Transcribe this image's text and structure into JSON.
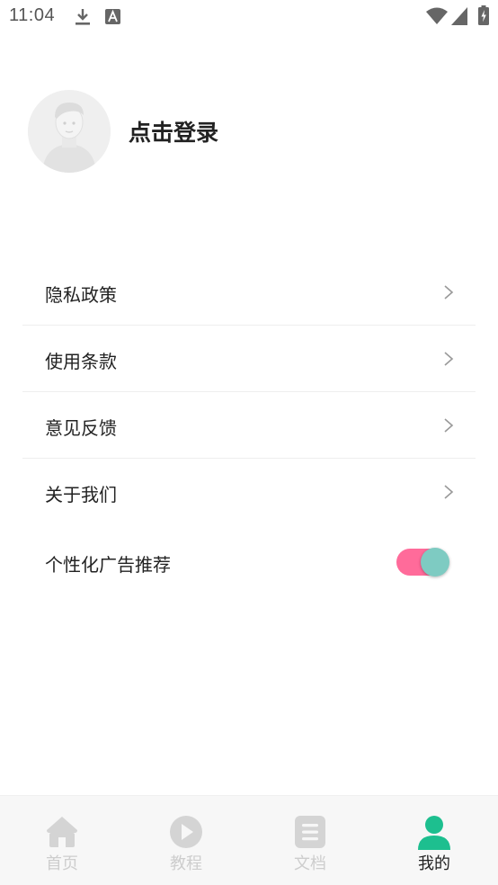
{
  "status_bar": {
    "time": "11:04",
    "icons": [
      "download-icon",
      "font-a-icon",
      "wifi-icon",
      "signal-icon",
      "battery-charging-icon"
    ]
  },
  "profile": {
    "login_label": "点击登录",
    "avatar_icon": "default-avatar-icon"
  },
  "menu": {
    "items": [
      {
        "label": "隐私政策",
        "icon": "chevron-right-icon"
      },
      {
        "label": "使用条款",
        "icon": "chevron-right-icon"
      },
      {
        "label": "意见反馈",
        "icon": "chevron-right-icon"
      },
      {
        "label": "关于我们",
        "icon": "chevron-right-icon"
      }
    ]
  },
  "ad_toggle": {
    "label": "个性化广告推荐",
    "enabled": true,
    "track_color": "#ff6b9a",
    "thumb_color": "#7ecbc2"
  },
  "bottom_nav": {
    "active_color": "#1dbf8f",
    "inactive_color": "#cdcdcd",
    "tabs": [
      {
        "label": "首页",
        "icon": "home-icon",
        "active": false
      },
      {
        "label": "教程",
        "icon": "play-circle-icon",
        "active": false
      },
      {
        "label": "文档",
        "icon": "document-icon",
        "active": false
      },
      {
        "label": "我的",
        "icon": "person-icon",
        "active": true
      }
    ]
  }
}
